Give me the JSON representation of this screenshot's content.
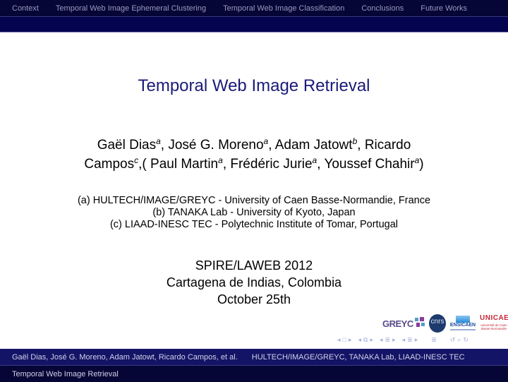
{
  "nav": {
    "sections": [
      "Context",
      "Temporal Web Image Ephemeral Clustering",
      "Temporal Web Image Classification",
      "Conclusions",
      "Future Works"
    ]
  },
  "slide": {
    "title": "Temporal Web Image Retrieval",
    "authors": [
      {
        "name": "Gaël Dias",
        "aff": "a",
        "sep": ", "
      },
      {
        "name": "José G. Moreno",
        "aff": "a",
        "sep": ", "
      },
      {
        "name": "Adam Jatowt",
        "aff": "b",
        "sep": ", "
      },
      {
        "name": "Ricardo Campos",
        "aff": "c",
        "sep": ",( "
      },
      {
        "name": "Paul Martin",
        "aff": "a",
        "sep": ", "
      },
      {
        "name": "Frédéric Jurie",
        "aff": "a",
        "sep": ", "
      },
      {
        "name": "Youssef Chahir",
        "aff": "a",
        "sep": ")"
      }
    ],
    "affiliations": [
      "(a) HULTECH/IMAGE/GREYC - University of Caen Basse-Normandie, France",
      "(b) TANAKA Lab - University of Kyoto, Japan",
      "(c) LIAAD-INESC TEC - Polytechnic Institute of Tomar, Portugal"
    ],
    "venue": {
      "event": "SPIRE/LAWEB 2012",
      "location": "Cartagena de Indias, Colombia",
      "date": "October 25th"
    },
    "logos": {
      "greyc": "GREYC",
      "cnrs": "cnrs",
      "ensicaen": "ENSICAEN",
      "unicaen": "UNICAEN",
      "unicaen_sub1": "université de Caen",
      "unicaen_sub2": "Basse-Normandie"
    }
  },
  "beamer_nav": {
    "icons": [
      "◂",
      "□",
      "▸",
      "◂",
      "⧉",
      "▸",
      "◂",
      "≣",
      "▸",
      "◂",
      "≣",
      "▸",
      "≣",
      "↺",
      "🔍",
      "↻"
    ]
  },
  "footer": {
    "authors": "Gaël Dias, José G. Moreno, Adam Jatowt, Ricardo Campos, et al.",
    "institutions": "HULTECH/IMAGE/GREYC, TANAKA Lab, LIAAD-INESC TEC",
    "title": "Temporal Web Image Retrieval"
  },
  "colors": {
    "nav_bg": "#050536",
    "subbar_bg": "#03034f",
    "title": "#1a1a78",
    "footer_bg": "#141466"
  }
}
